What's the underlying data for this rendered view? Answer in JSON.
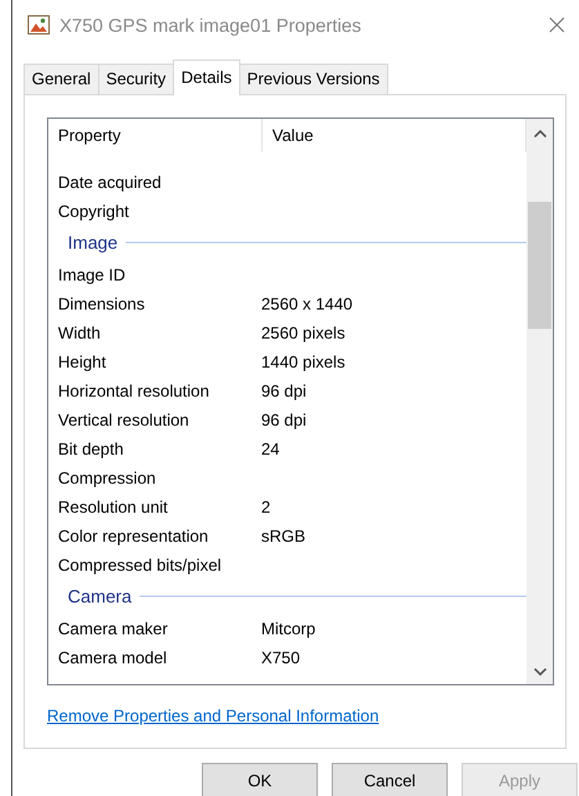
{
  "window": {
    "title": "X750 GPS mark image01 Properties"
  },
  "tabs": [
    {
      "label": "General",
      "selected": false
    },
    {
      "label": "Security",
      "selected": false
    },
    {
      "label": "Details",
      "selected": true
    },
    {
      "label": "Previous Versions",
      "selected": false
    }
  ],
  "table": {
    "columns": [
      "Property",
      "Value"
    ],
    "rows": [
      {
        "kind": "row",
        "property": "Date acquired",
        "value": ""
      },
      {
        "kind": "row",
        "property": "Copyright",
        "value": ""
      },
      {
        "kind": "group",
        "property": "Image"
      },
      {
        "kind": "row",
        "property": "Image ID",
        "value": ""
      },
      {
        "kind": "row",
        "property": "Dimensions",
        "value": "2560 x 1440"
      },
      {
        "kind": "row",
        "property": "Width",
        "value": "2560 pixels"
      },
      {
        "kind": "row",
        "property": "Height",
        "value": "1440 pixels"
      },
      {
        "kind": "row",
        "property": "Horizontal resolution",
        "value": "96 dpi"
      },
      {
        "kind": "row",
        "property": "Vertical resolution",
        "value": "96 dpi"
      },
      {
        "kind": "row",
        "property": "Bit depth",
        "value": "24"
      },
      {
        "kind": "row",
        "property": "Compression",
        "value": ""
      },
      {
        "kind": "row",
        "property": "Resolution unit",
        "value": "2"
      },
      {
        "kind": "row",
        "property": "Color representation",
        "value": "sRGB"
      },
      {
        "kind": "row",
        "property": "Compressed bits/pixel",
        "value": ""
      },
      {
        "kind": "group",
        "property": "Camera"
      },
      {
        "kind": "row",
        "property": "Camera maker",
        "value": "Mitcorp"
      },
      {
        "kind": "row",
        "property": "Camera model",
        "value": "X750"
      }
    ]
  },
  "link": "Remove Properties and Personal Information",
  "buttons": [
    {
      "label": "OK",
      "disabled": false
    },
    {
      "label": "Cancel",
      "disabled": false
    },
    {
      "label": "Apply",
      "disabled": true
    }
  ]
}
